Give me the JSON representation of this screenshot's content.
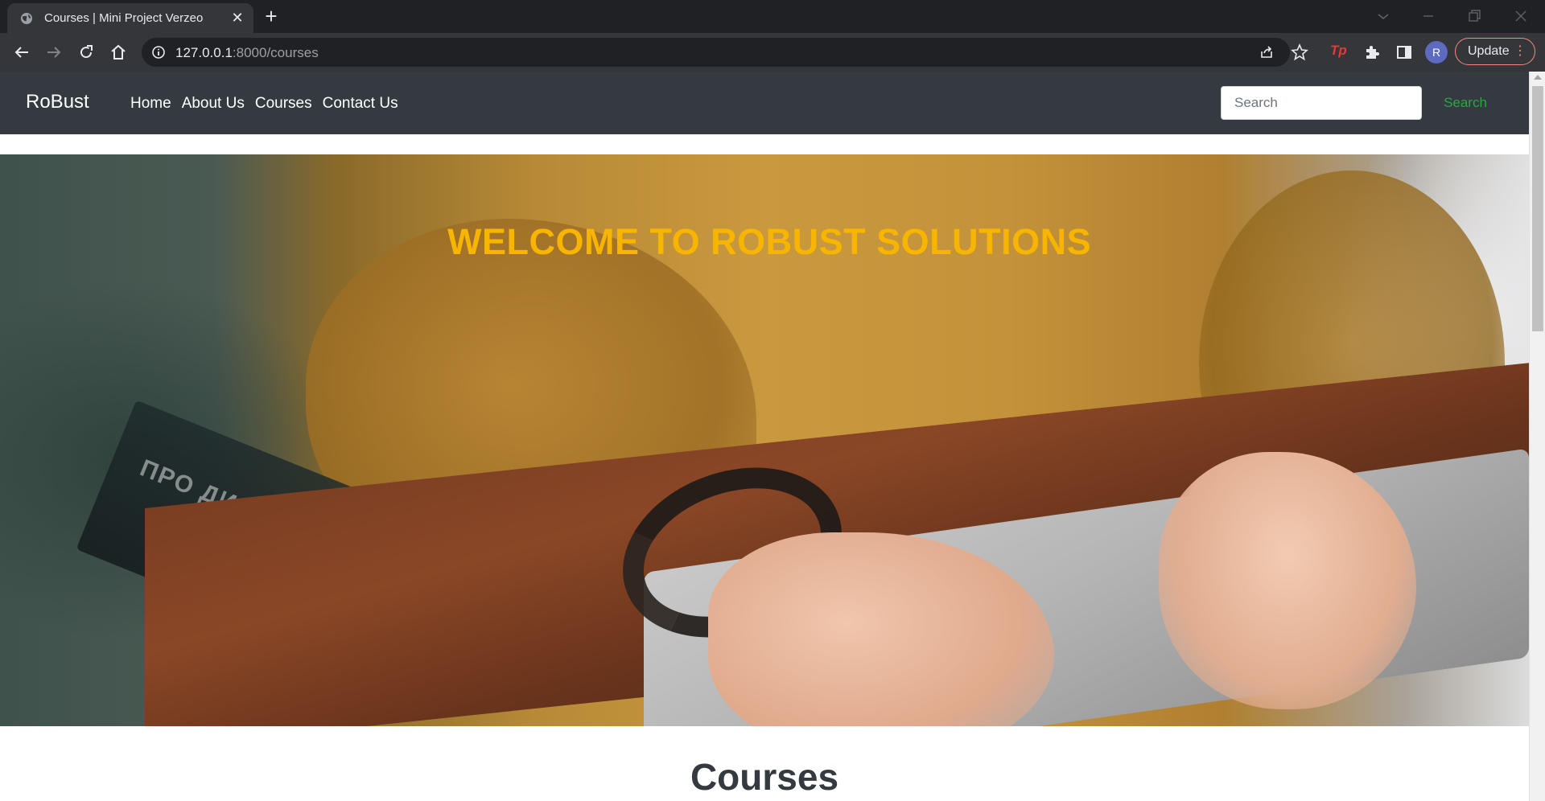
{
  "browser": {
    "tab_title": "Courses | Mini Project Verzeo",
    "url_host": "127.0.0.1",
    "url_rest": ":8000/courses",
    "profile_initial": "R",
    "update_label": "Update",
    "extension_label": "Tp"
  },
  "site": {
    "brand": "RoBust",
    "nav": [
      {
        "label": "Home"
      },
      {
        "label": "About Us"
      },
      {
        "label": "Courses"
      },
      {
        "label": "Contact Us"
      }
    ],
    "search": {
      "placeholder": "Search",
      "button": "Search"
    },
    "hero_title": "WELCOME TO ROBUST SOLUTIONS",
    "hero_book_text": "ПРО ДИЗ",
    "section_title": "Courses",
    "colors": {
      "navbar": "#343a40",
      "hero_title": "#f7b500",
      "search_button": "#28a745"
    }
  }
}
